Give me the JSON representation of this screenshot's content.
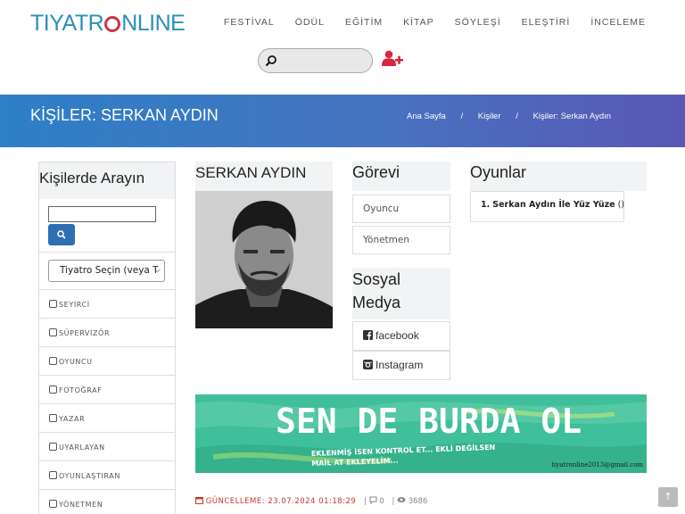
{
  "header": {
    "logo": "TIYATRONLINE",
    "nav": [
      "FESTİVAL",
      "ÖDÜL",
      "EĞİTİM",
      "KİTAP",
      "SÖYLEŞİ",
      "ELEŞTİRİ",
      "İNCELEME"
    ],
    "search_placeholder": ""
  },
  "banner": {
    "title": "KİŞİLER: SERKAN AYDIN",
    "breadcrumb": [
      "Ana Sayfa",
      "Kişiler",
      "Kişiler: Serkan Aydın"
    ],
    "breadcrumb_sep": "/"
  },
  "sidebar": {
    "title": "Kişilerde Arayın",
    "search_value": "",
    "theatre_select": "Tiyatro Seçin (veya T",
    "roles": [
      "SEYİRCİ",
      "SÜPERVİZÖR",
      "OYUNCU",
      "FOTOĞRAF",
      "YAZAR",
      "UYARLAYAN",
      "OYUNLAŞTIRAN",
      "YÖNETMEN"
    ]
  },
  "person": {
    "name": "SERKAN AYDIN"
  },
  "duties": {
    "title": "Görevi",
    "items": [
      "Oyuncu",
      "Yönetmen"
    ]
  },
  "social": {
    "title_line1": "Sosyal",
    "title_line2": "Medya",
    "items": [
      "facebook",
      "Instagram"
    ]
  },
  "plays": {
    "title": "Oyunlar",
    "items": [
      {
        "index": "1.",
        "name": "Serkan Aydın İle Yüz Yüze",
        "suffix": " ()"
      }
    ]
  },
  "ad": {
    "headline": "SEN DE BURDA OL",
    "subline": "EKLENMİŞ İSEN KONTROL ET... EKLİ DEĞİLSEN MAİL AT EKLEYELİM...",
    "email": "tiyatronline2013@gmail.com"
  },
  "meta": {
    "updated": "GÜNCELLEME: 23.07.2024 01:18:29",
    "comments": "0",
    "views": "3686"
  },
  "colors": {
    "brand": "#2b8fb8",
    "accent_red": "#d9263a",
    "banner_start": "#2d7fc6",
    "banner_end": "#5a58b4",
    "button_blue": "#2f6eb3",
    "ad_green": "#3fbf9a"
  },
  "icons": [
    "search-icon",
    "add-user-icon",
    "facebook-icon",
    "instagram-icon",
    "calendar-icon",
    "comment-icon",
    "eye-icon",
    "arrow-up-icon"
  ]
}
